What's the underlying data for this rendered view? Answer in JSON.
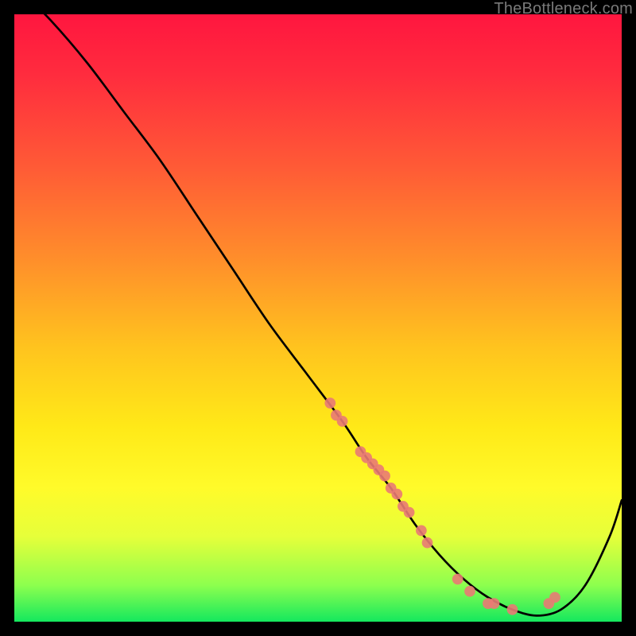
{
  "watermark": "TheBottleneck.com",
  "chart_data": {
    "type": "line",
    "title": "",
    "xlabel": "",
    "ylabel": "",
    "xlim": [
      0,
      100
    ],
    "ylim": [
      0,
      100
    ],
    "series": [
      {
        "name": "bottleneck-curve",
        "x": [
          0,
          6,
          12,
          18,
          24,
          30,
          36,
          42,
          48,
          54,
          58,
          62,
          66,
          70,
          74,
          78,
          82,
          86,
          90,
          94,
          98,
          100
        ],
        "values": [
          105,
          99,
          92,
          84,
          76,
          67,
          58,
          49,
          41,
          33,
          27,
          22,
          16,
          11,
          7,
          4,
          2,
          1,
          2,
          6,
          14,
          20
        ]
      }
    ],
    "scatter_points": {
      "name": "data-markers",
      "color": "#e97a74",
      "x": [
        52,
        53,
        54,
        57,
        58,
        59,
        60,
        61,
        62,
        63,
        64,
        65,
        67,
        68,
        73,
        75,
        78,
        79,
        82,
        88,
        89
      ],
      "y": [
        36,
        34,
        33,
        28,
        27,
        26,
        25,
        24,
        22,
        21,
        19,
        18,
        15,
        13,
        7,
        5,
        3,
        3,
        2,
        3,
        4
      ]
    }
  }
}
